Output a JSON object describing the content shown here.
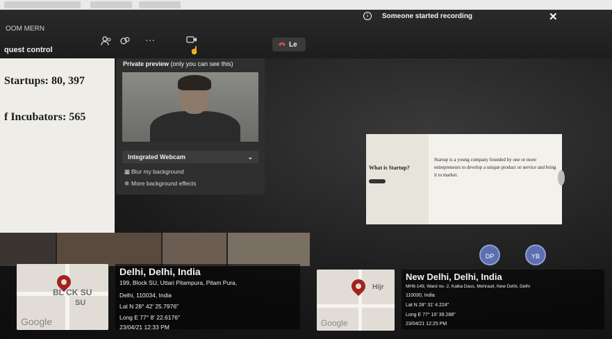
{
  "meeting": {
    "name": "OOM MERN",
    "request_control_label": "quest control",
    "leave_label": "Le"
  },
  "recording_banner": {
    "text": "Someone started recording",
    "close_glyph": "✕",
    "info_glyph": "i"
  },
  "slide_left": {
    "line1": "Startups: 80, 397",
    "line2": "f Incubators: 565"
  },
  "preview": {
    "title_bold": "Private preview",
    "title_rest": " (only you can see this)",
    "camera_label": "Integrated Webcam",
    "option_blur": "Blur my background",
    "option_more": "More background effects"
  },
  "slide_right": {
    "question": "What is Startup?",
    "answer": "Startup is a young company founded by one or more entrepreneurs to develop a unique product or service and bring it to market."
  },
  "participants": [
    {
      "initials": "DP"
    },
    {
      "initials": "YB"
    }
  ],
  "location_left": {
    "city": "Delhi, Delhi, India",
    "address_line1": "199, Block SU, Uttari Pitampura, Pitam Pura,",
    "address_line2": "Delhi, 110034, India",
    "lat": "Lat N 28° 42' 25.7976\"",
    "long": "Long E 77° 8' 22.6176\"",
    "timestamp": "23/04/21 12:33 PM",
    "map_label_top": "BL CK SU",
    "map_label_bottom": "SU",
    "google": "Google"
  },
  "location_right": {
    "city": "New Delhi, Delhi, India",
    "address_line1": "MH6-149, Ward no- 2, Kalka Dass, Mehrauli, New Delhi, Delhi",
    "address_line2": "110030, India",
    "lat": "Lat N 28° 31' 4.224\"",
    "long": "Long E 77° 10' 39.288\"",
    "timestamp": "23/04/21 12:25 PM",
    "map_label": "Hijr",
    "google": "Google"
  },
  "icons": {
    "people": "people-icon",
    "reactions": "reactions-icon",
    "more": "more-icon",
    "camera": "camera-icon",
    "phone": "phone-icon"
  }
}
